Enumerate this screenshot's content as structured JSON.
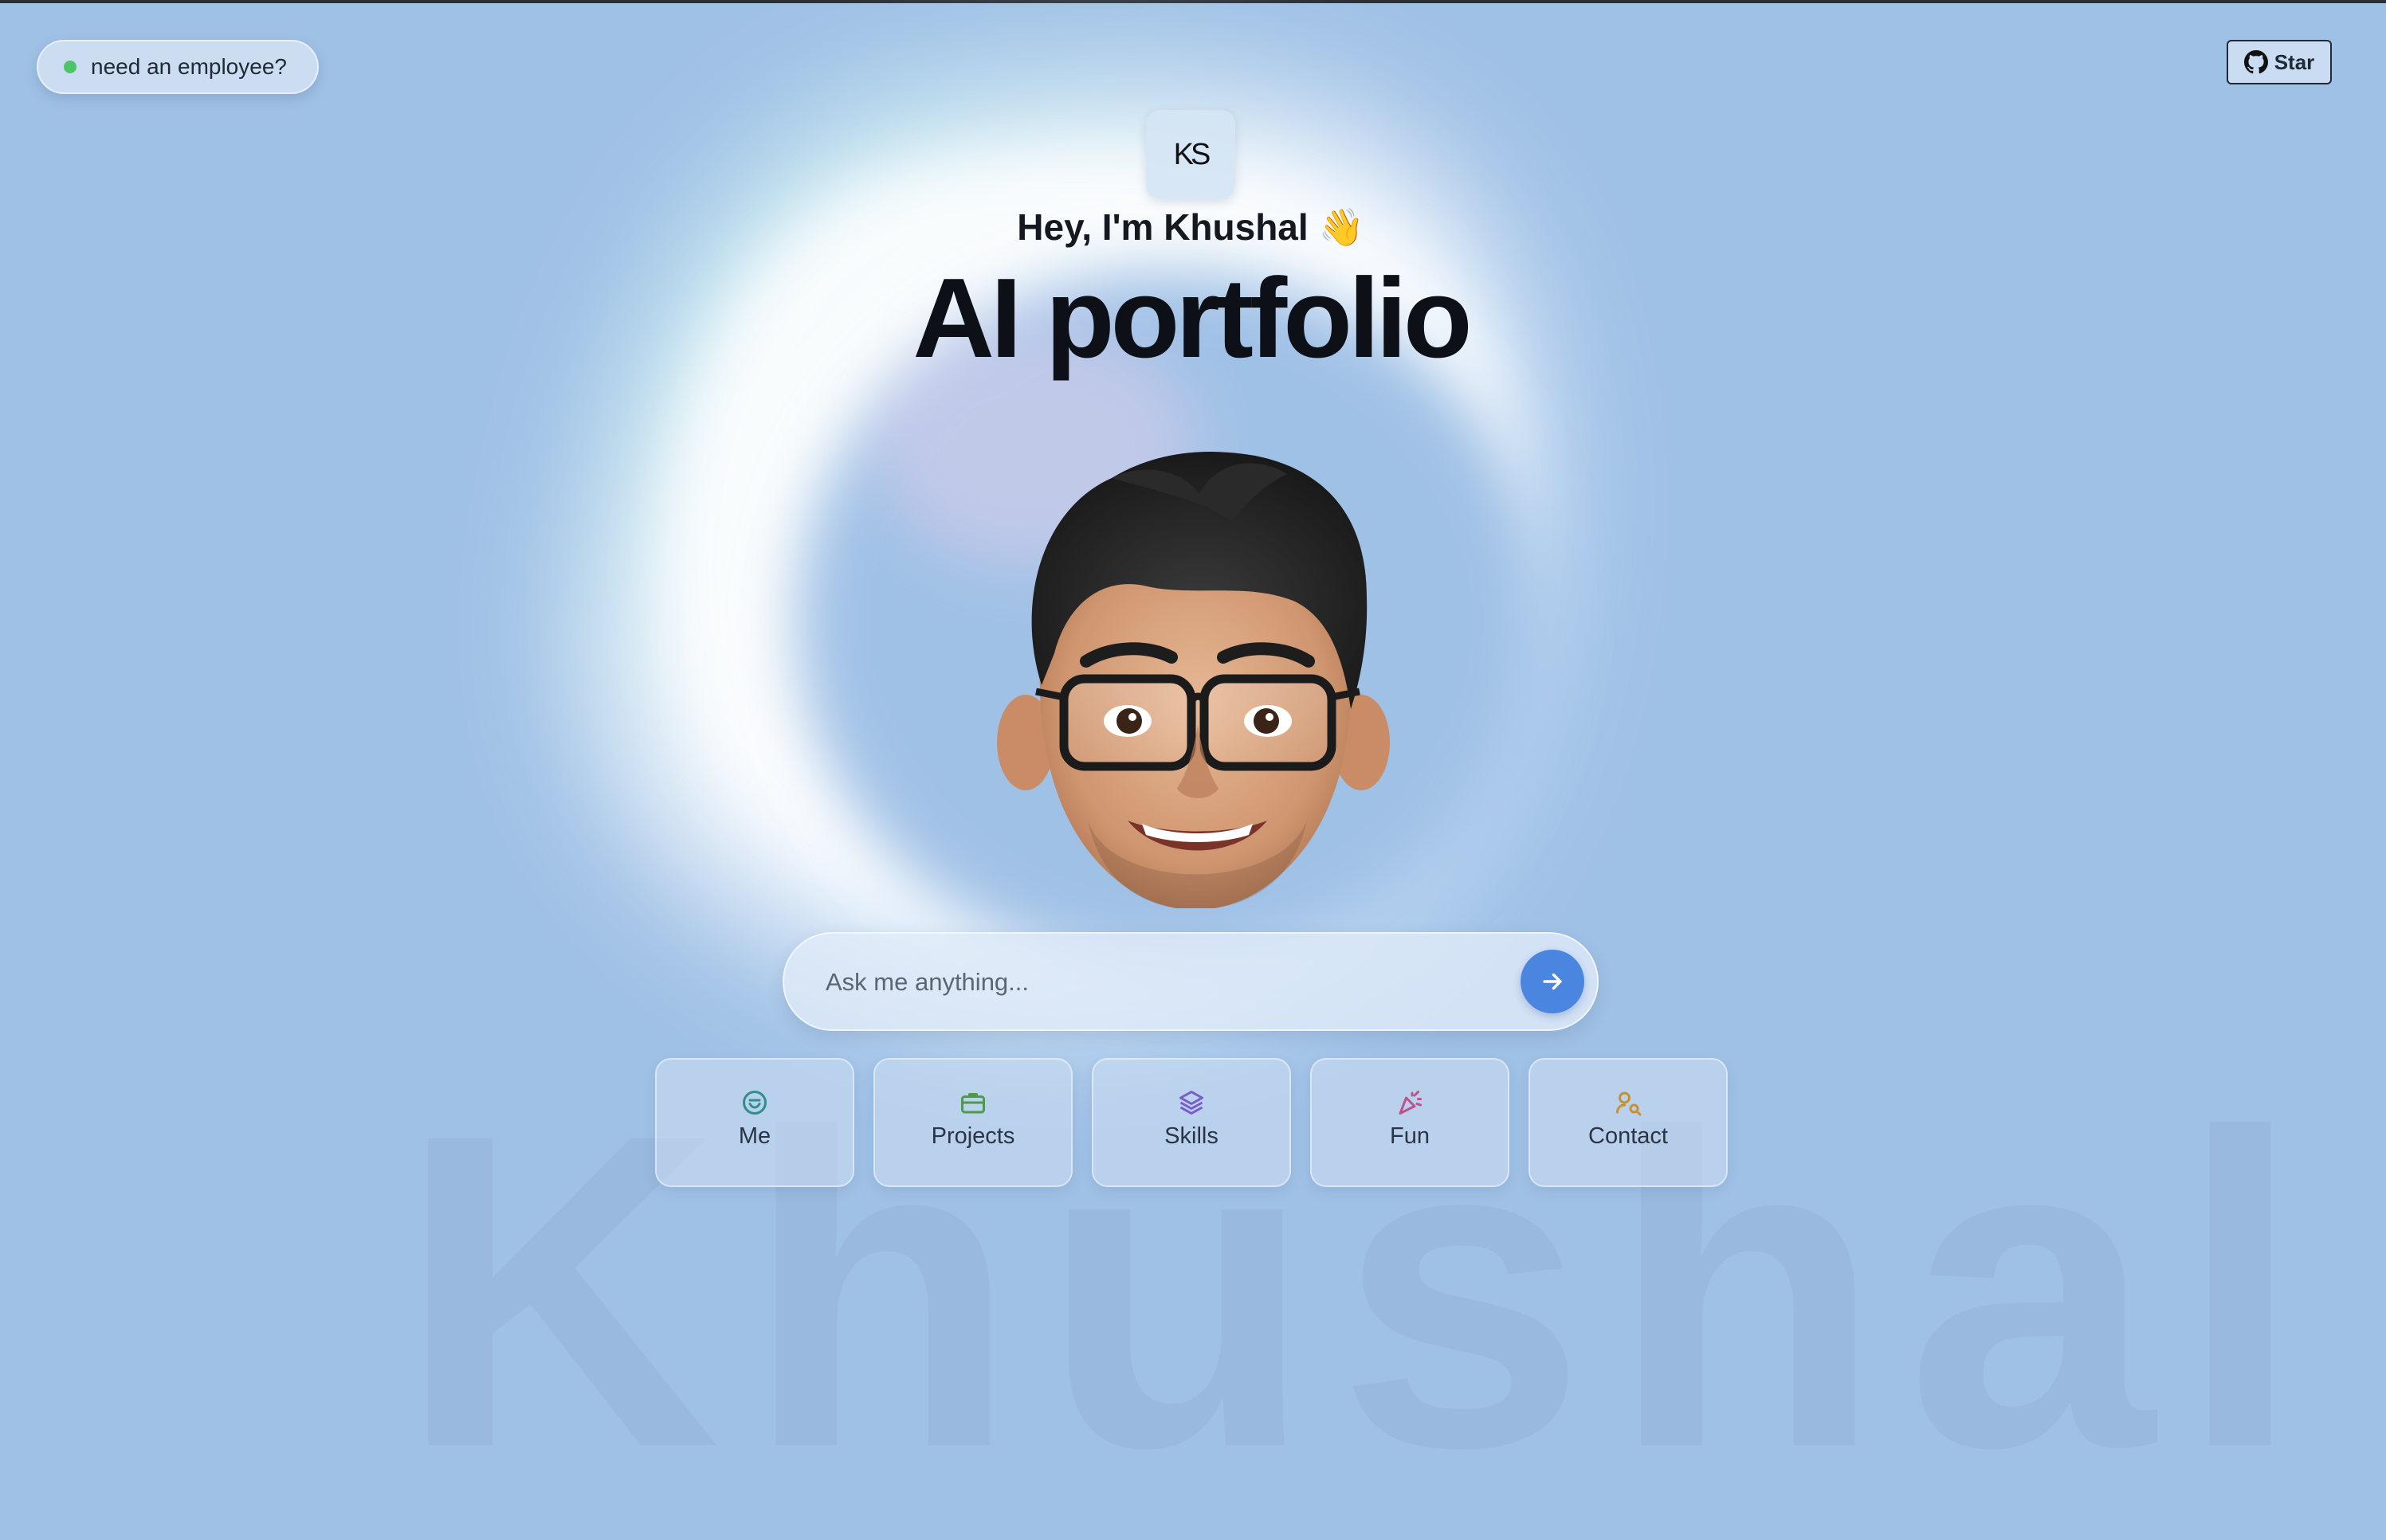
{
  "employee_badge": {
    "label": "need an employee?",
    "status_color": "#4cc569"
  },
  "github": {
    "label": "Star",
    "icon": "github-icon"
  },
  "logo": {
    "text": "KS"
  },
  "hero": {
    "greeting": "Hey, I'm Khushal 👋",
    "headline": "AI portfolio"
  },
  "avatar": {
    "description_icon": "memoji-avatar"
  },
  "search": {
    "placeholder": "Ask me anything...",
    "value": "",
    "submit_icon": "arrow-right-icon",
    "accent": "#4a86df"
  },
  "quick_nav": [
    {
      "label": "Me",
      "icon": "smile-icon",
      "icon_color": "#2f8f88"
    },
    {
      "label": "Projects",
      "icon": "briefcase-icon",
      "icon_color": "#4e9a48"
    },
    {
      "label": "Skills",
      "icon": "layers-icon",
      "icon_color": "#7a5cc8"
    },
    {
      "label": "Fun",
      "icon": "party-popper-icon",
      "icon_color": "#c0508a"
    },
    {
      "label": "Contact",
      "icon": "user-search-icon",
      "icon_color": "#c9902c"
    }
  ],
  "background": {
    "watermark": "Khushal",
    "color": "#a0c1e6"
  }
}
